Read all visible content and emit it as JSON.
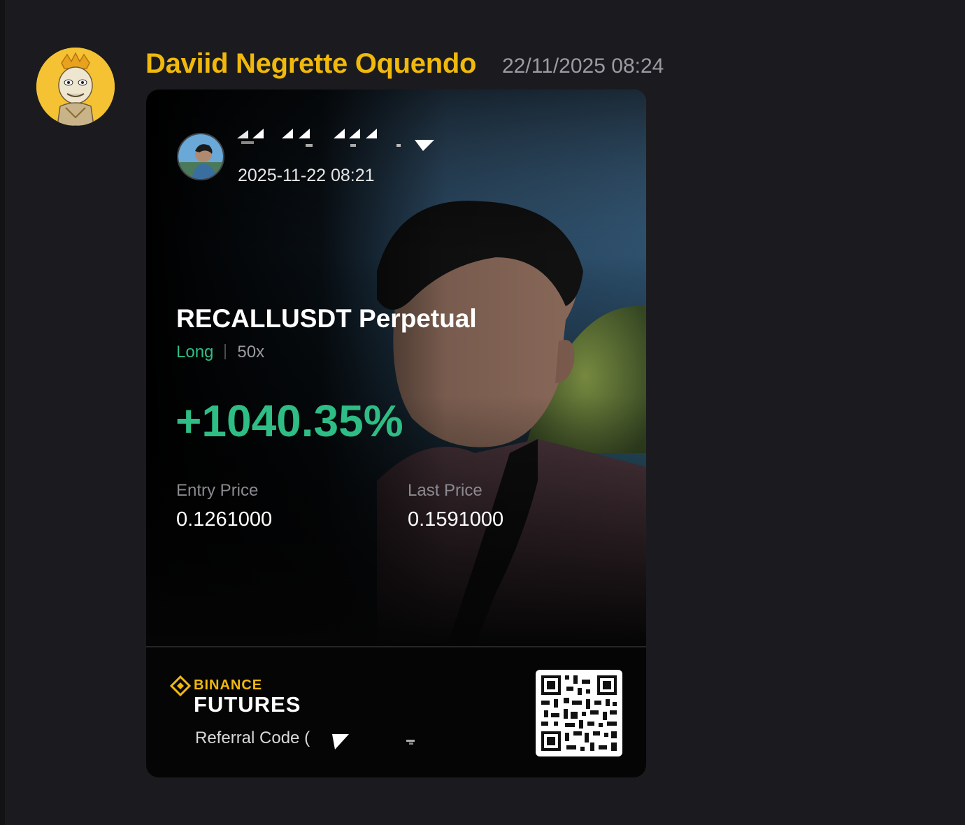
{
  "message": {
    "author": "Daviid Negrette Oquendo",
    "timestamp": "22/11/2025 08:24",
    "author_color": "#f0b90b"
  },
  "share_card": {
    "shared_at": "2025-11-22 08:21",
    "pair": "RECALLUSDT Perpetual",
    "side": "Long",
    "leverage": "50x",
    "roi": "+1040.35%",
    "entry_price_label": "Entry Price",
    "entry_price": "0.1261000",
    "last_price_label": "Last Price",
    "last_price": "0.1591000",
    "brand_top": "BINANCE",
    "brand_bottom": "FUTURES",
    "referral_label": "Referral Code (",
    "positive_color": "#2ebd85"
  }
}
